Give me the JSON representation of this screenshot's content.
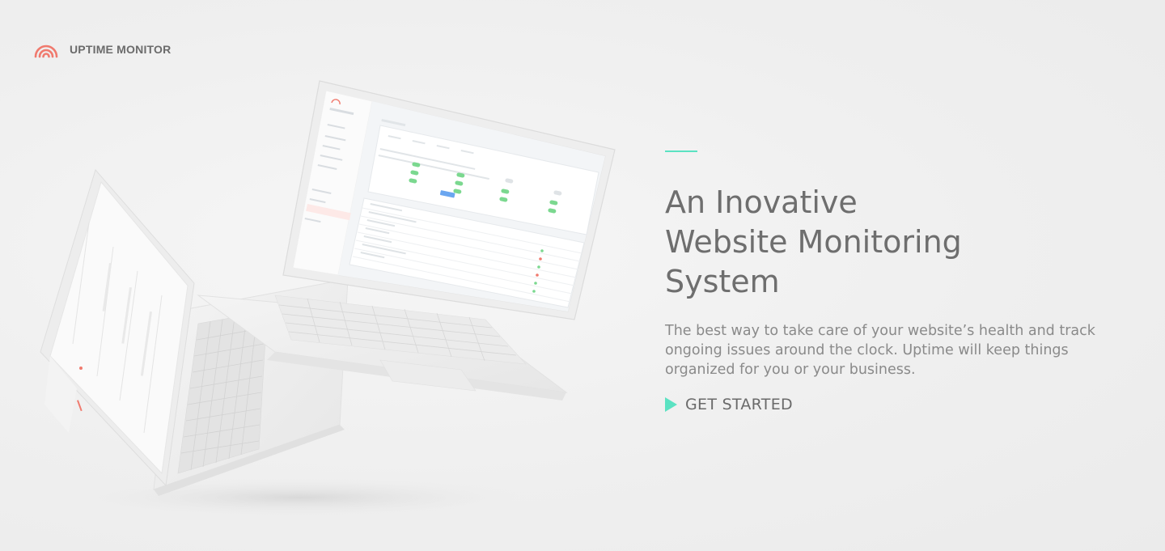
{
  "brand": {
    "name": "UPTIME MONITOR",
    "logo_icon": "rainbow-arcs-logo",
    "logo_color": "#f07a6e"
  },
  "hero": {
    "title_lines": [
      "An Inovative",
      "Website Monitoring",
      "System"
    ],
    "description": "The best way to take care of your website’s health and track ongoing issues around the clock. Uptime will keep things organized for you or your business.",
    "cta_label": "GET STARTED",
    "cta_icon": "play-triangle-icon",
    "accent_color": "#5be2c2"
  },
  "colors": {
    "background": "#efefef",
    "title": "#6e6e6e",
    "body_text": "#8a8a8a"
  }
}
